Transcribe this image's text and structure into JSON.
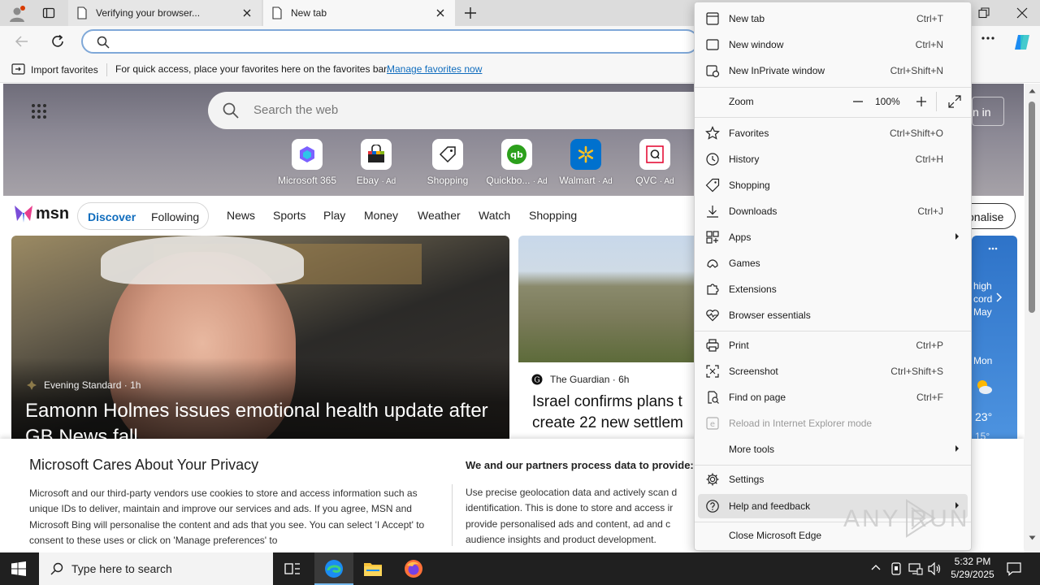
{
  "tabs": [
    {
      "title": "Verifying your browser..."
    },
    {
      "title": "New tab"
    }
  ],
  "favorites_bar": {
    "import_label": "Import favorites",
    "hint": "For quick access, place your favorites here on the favorites bar.",
    "manage_link": "Manage favorites now"
  },
  "hero": {
    "search_placeholder": "Search the web",
    "signin_partial": "n in",
    "tiles": [
      {
        "label": "Microsoft 365",
        "ad": ""
      },
      {
        "label": "Ebay",
        "ad": "· Ad"
      },
      {
        "label": "Shopping",
        "ad": ""
      },
      {
        "label": "Quickbo...",
        "ad": "· Ad"
      },
      {
        "label": "Walmart",
        "ad": "· Ad"
      },
      {
        "label": "QVC",
        "ad": "· Ad"
      }
    ]
  },
  "msn": {
    "logo": "msn",
    "discover": "Discover",
    "following": "Following",
    "links": [
      "News",
      "Sports",
      "Play",
      "Money",
      "Weather",
      "Watch",
      "Shopping"
    ],
    "personalise_partial": "onalise"
  },
  "cards": {
    "main": {
      "source": "Evening Standard",
      "age": "· 1h",
      "headline": "Eamonn Holmes issues emotional health update after GB News fall"
    },
    "second": {
      "source": "The Guardian",
      "age": "· 6h",
      "headline_line1": "Israel confirms plans t",
      "headline_line2": "create 22 new settlem"
    },
    "weather": {
      "text1": "high",
      "text2": "cord",
      "text3": "May",
      "day": "Mon",
      "temp_high": "23°",
      "temp_low": "15°"
    }
  },
  "privacy": {
    "title": "Microsoft Cares About Your Privacy",
    "body": "Microsoft and our third-party vendors use cookies to store and access information such as unique IDs to deliver, maintain and improve our services and ads. If you agree, MSN and Microsoft Bing will personalise the content and ads that you see. You can select 'I Accept' to consent to these uses or click on 'Manage preferences' to",
    "right_title": "We and our partners process data to provide:",
    "right_body": "Use precise geolocation data and actively scan d identification. This is done to store and access ir provide personalised ads and content, ad and c audience insights and product development."
  },
  "menu": {
    "items": [
      {
        "label": "New tab",
        "shortcut": "Ctrl+T"
      },
      {
        "label": "New window",
        "shortcut": "Ctrl+N"
      },
      {
        "label": "New InPrivate window",
        "shortcut": "Ctrl+Shift+N"
      },
      {
        "label": "Zoom",
        "shortcut": ""
      },
      {
        "label": "Favorites",
        "shortcut": "Ctrl+Shift+O"
      },
      {
        "label": "History",
        "shortcut": "Ctrl+H"
      },
      {
        "label": "Shopping",
        "shortcut": ""
      },
      {
        "label": "Downloads",
        "shortcut": "Ctrl+J"
      },
      {
        "label": "Apps",
        "shortcut": ""
      },
      {
        "label": "Games",
        "shortcut": ""
      },
      {
        "label": "Extensions",
        "shortcut": ""
      },
      {
        "label": "Browser essentials",
        "shortcut": ""
      },
      {
        "label": "Print",
        "shortcut": "Ctrl+P"
      },
      {
        "label": "Screenshot",
        "shortcut": "Ctrl+Shift+S"
      },
      {
        "label": "Find on page",
        "shortcut": "Ctrl+F"
      },
      {
        "label": "Reload in Internet Explorer mode",
        "shortcut": ""
      },
      {
        "label": "More tools",
        "shortcut": ""
      },
      {
        "label": "Settings",
        "shortcut": ""
      },
      {
        "label": "Help and feedback",
        "shortcut": ""
      },
      {
        "label": "Close Microsoft Edge",
        "shortcut": ""
      }
    ],
    "zoom_value": "100%"
  },
  "taskbar": {
    "search_placeholder": "Type here to search",
    "time": "5:32 PM",
    "date": "5/29/2025"
  },
  "watermark": "ANY RUN",
  "colors": {
    "accent": "#0f6cbd",
    "link": "#0f6cbd",
    "taskbar": "#202020",
    "menu_hover": "#e2e2e2"
  }
}
